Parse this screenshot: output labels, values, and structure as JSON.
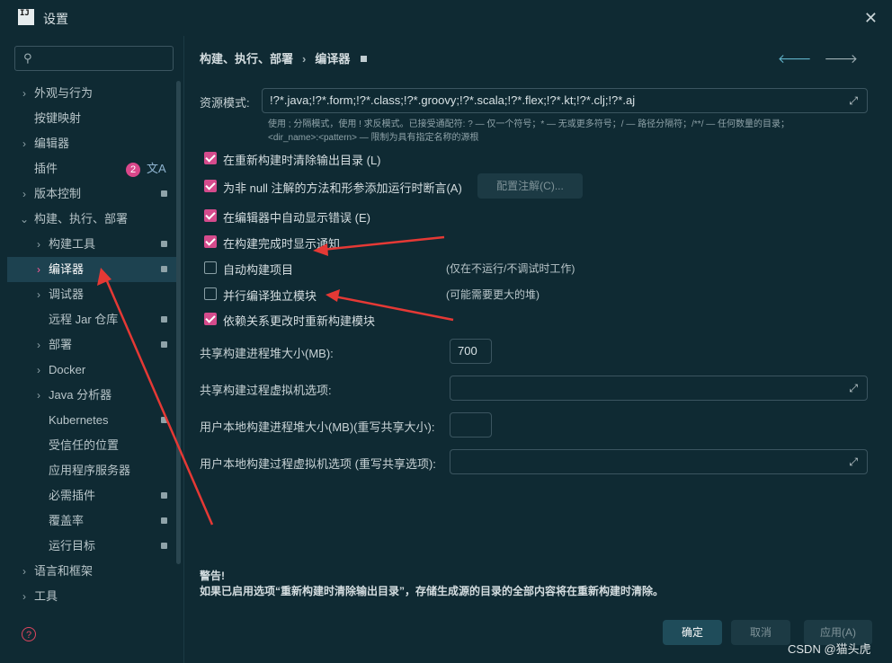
{
  "window": {
    "title": "设置",
    "app_icon": "IJ"
  },
  "sidebar": {
    "search_placeholder": "",
    "plugin_badge": "2",
    "items": [
      {
        "label": "外观与行为",
        "chevron": "›"
      },
      {
        "label": "按键映射",
        "chevron": ""
      },
      {
        "label": "编辑器",
        "chevron": "›"
      },
      {
        "label": "插件",
        "chevron": ""
      },
      {
        "label": "版本控制",
        "chevron": "›"
      },
      {
        "label": "构建、执行、部署",
        "chevron": "⌄"
      },
      {
        "label": "构建工具",
        "chevron": "›"
      },
      {
        "label": "编译器",
        "chevron": "›"
      },
      {
        "label": "调试器",
        "chevron": "›"
      },
      {
        "label": "远程 Jar 仓库",
        "chevron": ""
      },
      {
        "label": "部署",
        "chevron": "›"
      },
      {
        "label": "Docker",
        "chevron": "›"
      },
      {
        "label": "Java 分析器",
        "chevron": "›"
      },
      {
        "label": "Kubernetes",
        "chevron": ""
      },
      {
        "label": "受信任的位置",
        "chevron": ""
      },
      {
        "label": "应用程序服务器",
        "chevron": ""
      },
      {
        "label": "必需插件",
        "chevron": ""
      },
      {
        "label": "覆盖率",
        "chevron": ""
      },
      {
        "label": "运行目标",
        "chevron": ""
      },
      {
        "label": "语言和框架",
        "chevron": "›"
      },
      {
        "label": "工具",
        "chevron": "›"
      }
    ]
  },
  "content": {
    "breadcrumb": {
      "parent": "构建、执行、部署",
      "separator": "›",
      "current": "编译器"
    },
    "resource_pattern": {
      "label": "资源模式:",
      "value": "!?*.java;!?*.form;!?*.class;!?*.groovy;!?*.scala;!?*.flex;!?*.kt;!?*.clj;!?*.aj",
      "hint_line1": "使用 ; 分隔模式，使用 ! 求反模式。已接受通配符: ? — 仅一个符号；* — 无或更多符号；/ — 路径分隔符；/**/ — 任何数量的目录；",
      "hint_line2": "<dir_name>:<pattern> — 限制为具有指定名称的源根"
    },
    "checkboxes": [
      {
        "label": "在重新构建时清除输出目录 (L)",
        "checked": true
      },
      {
        "label": "为非 null 注解的方法和形参添加运行时断言(A)",
        "checked": true
      },
      {
        "label": "在编辑器中自动显示错误 (E)",
        "checked": true
      },
      {
        "label": "在构建完成时显示通知",
        "checked": true
      },
      {
        "label": "自动构建项目",
        "checked": false,
        "note": "(仅在不运行/不调试时工作)"
      },
      {
        "label": "并行编译独立模块",
        "checked": false,
        "note": "(可能需要更大的堆)"
      },
      {
        "label": "依赖关系更改时重新构建模块",
        "checked": true
      }
    ],
    "config_annotations_button": "配置注解(C)...",
    "fields": [
      {
        "label": "共享构建进程堆大小(MB):",
        "value": "700"
      },
      {
        "label": "共享构建过程虚拟机选项:",
        "value": ""
      },
      {
        "label": "用户本地构建进程堆大小(MB)(重写共享大小):",
        "value": ""
      },
      {
        "label": "用户本地构建过程虚拟机选项 (重写共享选项):",
        "value": ""
      }
    ],
    "warning": {
      "title": "警告!",
      "text": "如果已启用选项“重新构建时清除输出目录”，存储生成源的目录的全部内容将在重新构建时清除。"
    }
  },
  "footer": {
    "ok": "确定",
    "cancel": "取消",
    "apply": "应用(A)"
  },
  "watermark": "CSDN @猫头虎",
  "colors": {
    "accent": "#d54b8c",
    "background": "#0f2a33",
    "selected": "#1d4250",
    "annotation_arrow": "#e53935"
  }
}
